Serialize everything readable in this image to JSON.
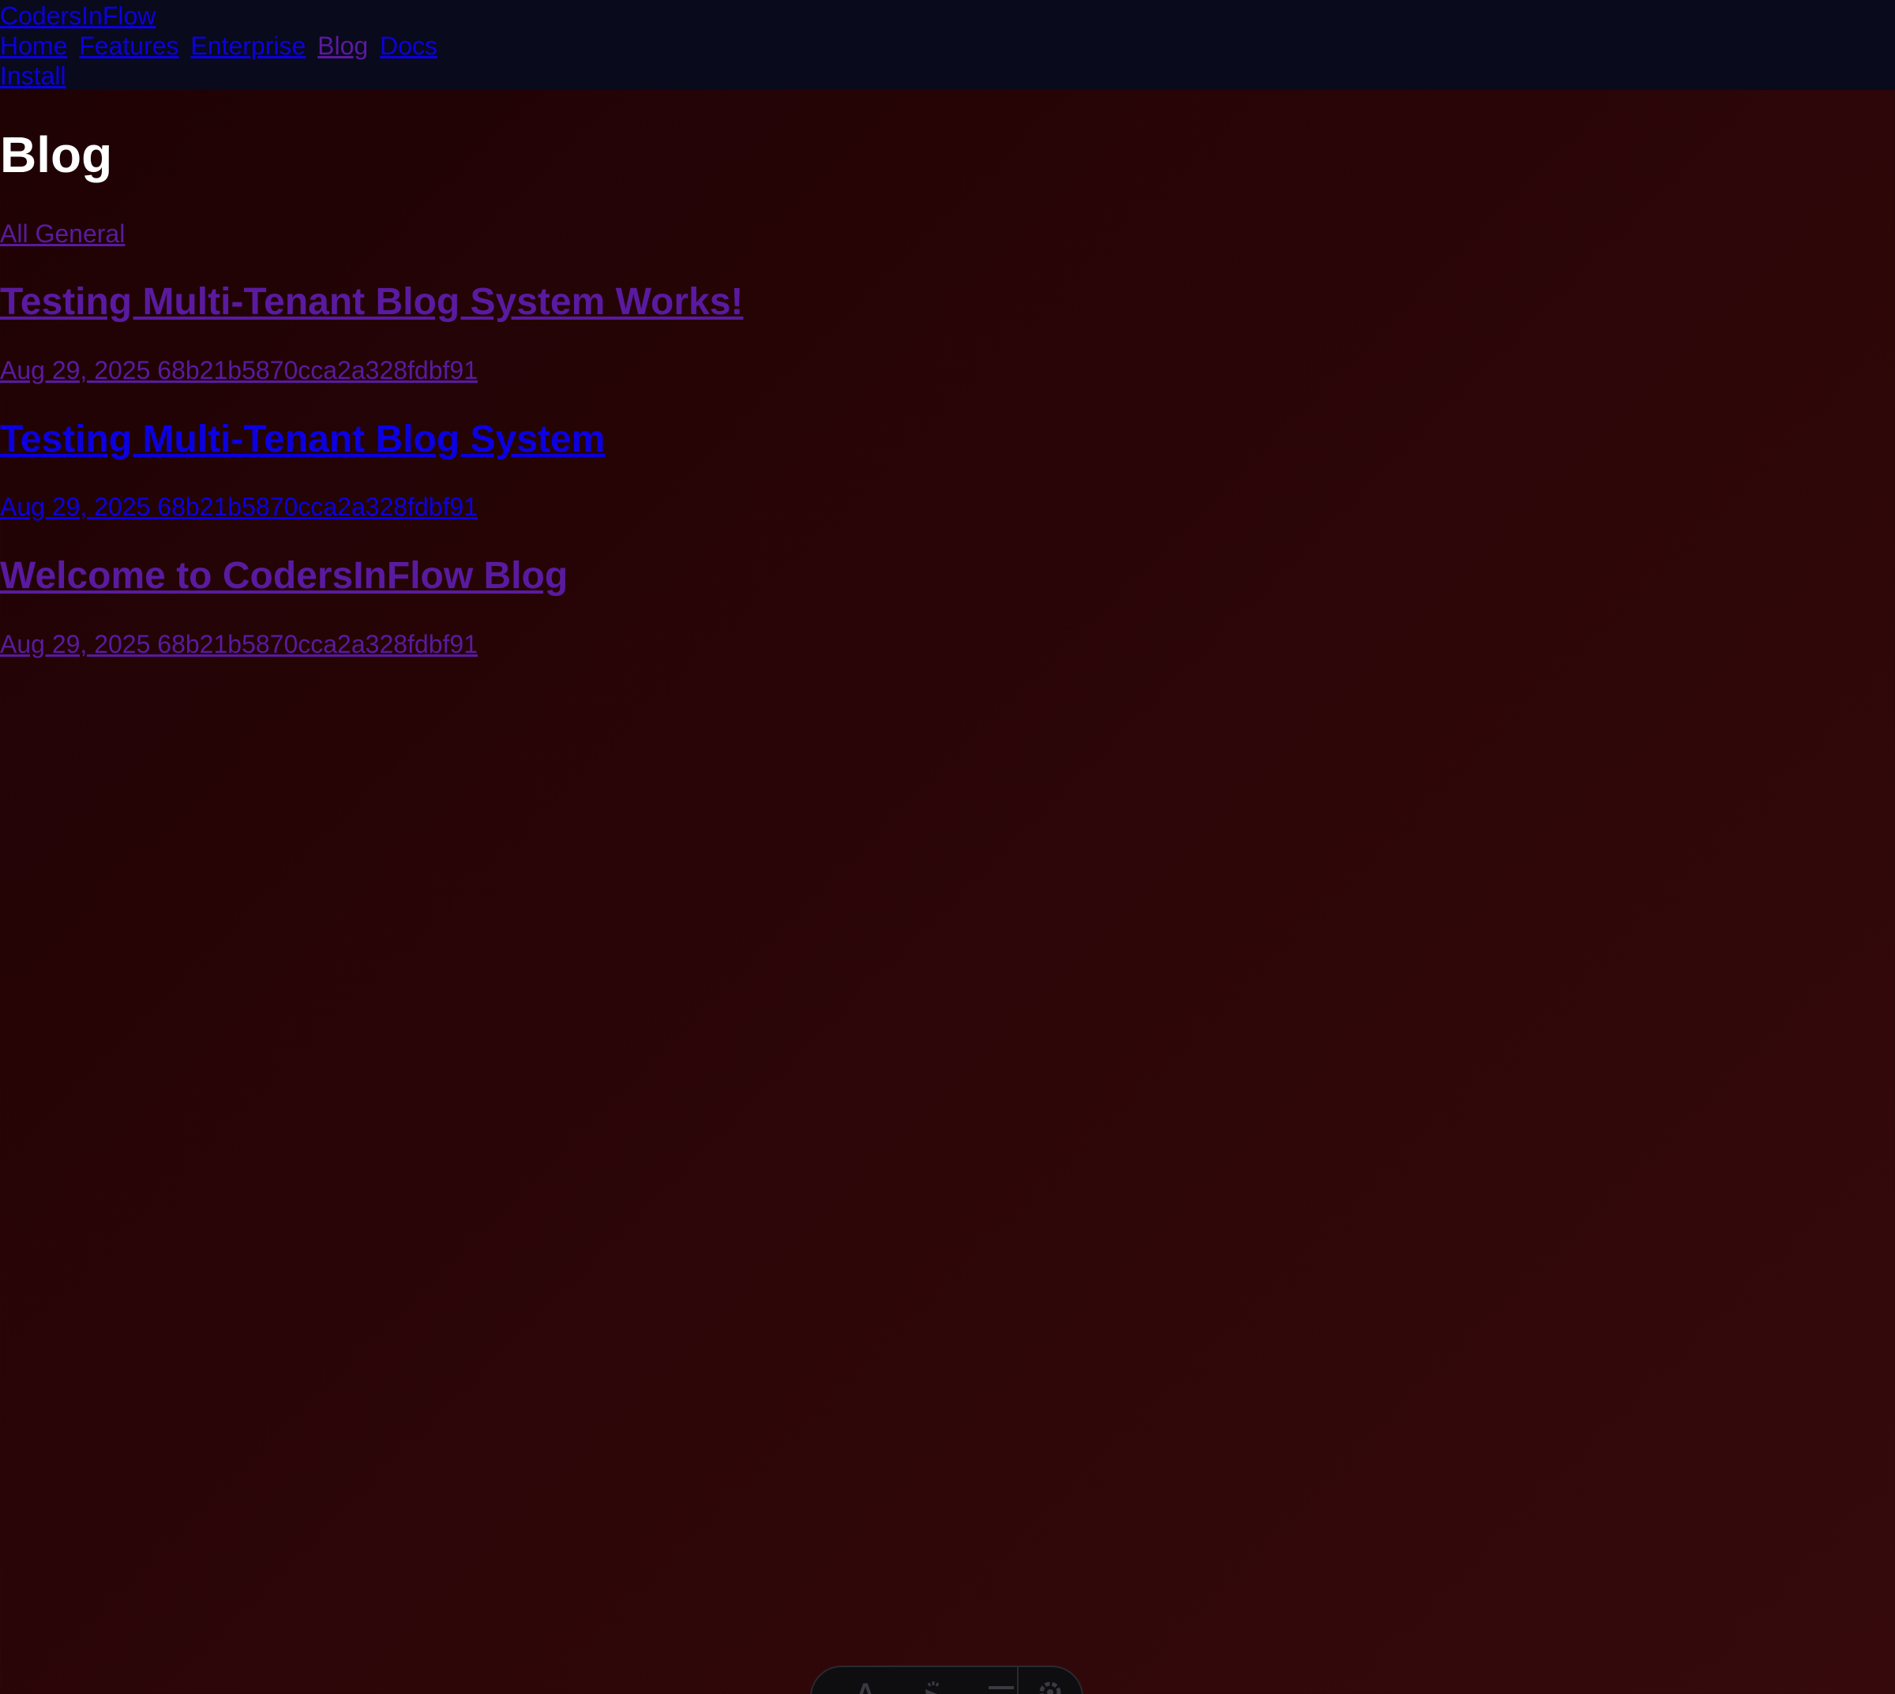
{
  "header": {
    "brand": "CodersInFlow",
    "nav": [
      "Home",
      "Features",
      "Enterprise",
      "Blog",
      "Docs"
    ],
    "install": "Install"
  },
  "main": {
    "title": "Blog",
    "filters": "All General",
    "posts": [
      {
        "title": "Testing Multi-Tenant Blog System Works!",
        "meta": "Aug 29, 2025 68b21b5870cca2a328fdbf91"
      },
      {
        "title": "Testing Multi-Tenant Blog System",
        "meta": "Aug 29, 2025 68b21b5870cca2a328fdbf91"
      },
      {
        "title": "Welcome to CodersInFlow Blog",
        "meta": "Aug 29, 2025 68b21b5870cca2a328fdbf91"
      }
    ]
  },
  "colors": {
    "link": "#0c00e0",
    "visited_link": "#5a1aa0",
    "header_bg": "#090a1c",
    "page_bg": "#2a0507"
  },
  "toolbar": {
    "icons": [
      "text-icon",
      "pointer-icon",
      "menu-icon",
      "settings-icon"
    ]
  }
}
